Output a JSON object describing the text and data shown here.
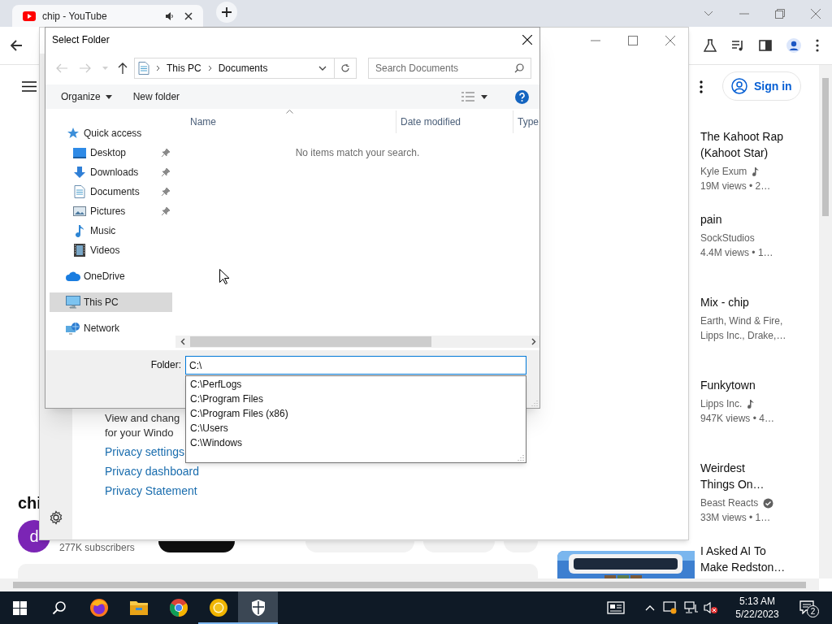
{
  "browser": {
    "tab": {
      "title": "chip - YouTube",
      "audio": true
    }
  },
  "youtube": {
    "sign_in": "Sign in",
    "videos": [
      {
        "title_lines": [
          "The Kahoot Rap",
          "(Kahoot Star)"
        ],
        "lines": [
          {
            "text": "Kyle Exum",
            "kind": "music"
          },
          {
            "text": "19M views • 2…"
          }
        ]
      },
      {
        "title_lines": [
          "pain"
        ],
        "lines": [
          {
            "text": "SockStudios"
          },
          {
            "text": "4.4M views • 1…"
          }
        ]
      },
      {
        "title_lines": [
          "Mix - chip"
        ],
        "lines": [
          {
            "text": "Earth, Wind & Fire,"
          },
          {
            "text": "Lipps Inc., Drake,…"
          }
        ]
      },
      {
        "title_lines": [
          "Funkytown"
        ],
        "lines": [
          {
            "text": "Lipps Inc.",
            "kind": "music"
          },
          {
            "text": "947K views • 4…"
          }
        ]
      },
      {
        "title_lines": [
          "Weirdest",
          "Things On…"
        ],
        "lines": [
          {
            "text": "Beast Reacts",
            "kind": "verified"
          },
          {
            "text": "33M views • 1…"
          }
        ]
      },
      {
        "title_lines": [
          "I Asked AI To",
          "Make Redston…"
        ],
        "thumbnail": {
          "kind": "picture"
        }
      }
    ],
    "channel": {
      "title": "chi",
      "avatar": "d",
      "subscribers": "277K subscribers"
    }
  },
  "settings_window": {
    "lines": [
      "View and chang",
      "for your Windo"
    ],
    "links": [
      "Privacy settings",
      "Privacy dashboard",
      "Privacy Statement"
    ]
  },
  "dialog": {
    "title": "Select Folder",
    "back": {
      "disabled": true
    },
    "forward": {
      "disabled": true
    },
    "breadcrumb": [
      "This PC",
      "Documents"
    ],
    "search": {
      "placeholder": "Search Documents"
    },
    "commands": [
      {
        "label": "Organize",
        "menu": true
      },
      {
        "label": "New folder",
        "menu": false
      }
    ],
    "nav": [
      {
        "label": "Quick access",
        "kind": "star",
        "selected": false,
        "children": [
          {
            "label": "Desktop",
            "kind": "desktop",
            "pinned": true,
            "selected": false
          },
          {
            "label": "Downloads",
            "kind": "download",
            "pinned": true,
            "selected": false
          },
          {
            "label": "Documents",
            "kind": "document",
            "pinned": true,
            "selected": false
          },
          {
            "label": "Pictures",
            "kind": "picture",
            "pinned": true,
            "selected": false
          },
          {
            "label": "Music",
            "kind": "music",
            "pinned": false,
            "selected": false
          },
          {
            "label": "Videos",
            "kind": "video",
            "pinned": false,
            "selected": false
          }
        ]
      },
      {
        "label": "OneDrive",
        "kind": "cloud",
        "selected": false
      },
      {
        "label": "This PC",
        "kind": "pc",
        "selected": true
      },
      {
        "label": "Network",
        "kind": "network",
        "selected": false
      }
    ],
    "columns": [
      {
        "label": "Name",
        "sorted": true
      },
      {
        "label": "Date modified",
        "sorted": false
      },
      {
        "label": "Type",
        "sorted": false
      }
    ],
    "empty_message": "No items match your search.",
    "folder": {
      "label": "Folder:",
      "value": "C:\\"
    },
    "suggestions": [
      "C:\\PerfLogs",
      "C:\\Program Files",
      "C:\\Program Files (x86)",
      "C:\\Users",
      "C:\\Windows"
    ]
  },
  "taskbar": {
    "apps": [
      {
        "kind": "search",
        "running": false,
        "active": false
      },
      {
        "kind": "firefox",
        "running": false,
        "active": false
      },
      {
        "kind": "explorer",
        "running": false,
        "active": false
      },
      {
        "kind": "chrome",
        "running": false,
        "active": false
      },
      {
        "kind": "canary",
        "running": true,
        "active": false
      },
      {
        "kind": "shield",
        "running": true,
        "active": true
      }
    ],
    "time": "5:13 AM",
    "date": "5/22/2023",
    "notifications": "2"
  }
}
